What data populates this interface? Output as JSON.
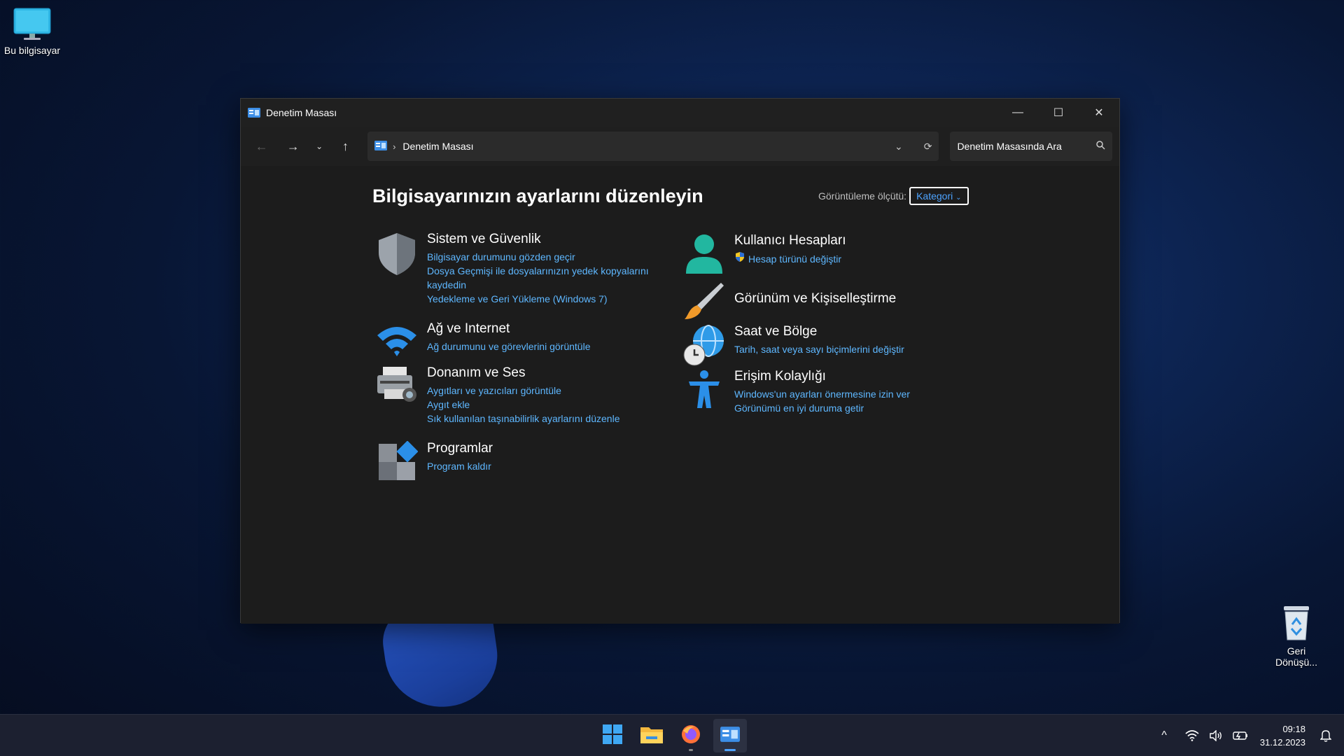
{
  "desktop": {
    "this_pc_label": "Bu bilgisayar",
    "recycle_bin_label_line1": "Geri",
    "recycle_bin_label_line2": "Dönüşü..."
  },
  "window": {
    "title": "Denetim Masası",
    "controls": {
      "minimize": "—",
      "maximize": "☐",
      "close": "✕"
    },
    "nav": {
      "back": "←",
      "forward": "→",
      "recent": "⌄",
      "up": "↑"
    },
    "address": {
      "crumb": "Denetim Masası",
      "separator": "›"
    },
    "search": {
      "placeholder": "Denetim Masasında Ara"
    },
    "page_title": "Bilgisayarınızın ayarlarını düzenleyin",
    "view_by": {
      "label": "Görüntüleme ölçütü:",
      "value": "Kategori"
    },
    "categories": [
      {
        "title": "Sistem ve Güvenlik",
        "links": [
          "Bilgisayar durumunu gözden geçir",
          "Dosya Geçmişi ile dosyalarınızın yedek kopyalarını",
          "kaydedin",
          "Yedekleme ve Geri Yükleme (Windows 7)"
        ]
      },
      {
        "title": "Ağ ve Internet",
        "links": [
          "Ağ durumunu ve görevlerini görüntüle"
        ]
      },
      {
        "title": "Donanım ve Ses",
        "links": [
          "Aygıtları ve yazıcıları görüntüle",
          "Aygıt ekle",
          "Sık kullanılan taşınabilirlik ayarlarını düzenle"
        ]
      },
      {
        "title": "Programlar",
        "links": [
          "Program kaldır"
        ]
      },
      {
        "title": "Kullanıcı Hesapları",
        "links": [
          "Hesap türünü değiştir"
        ]
      },
      {
        "title": "Görünüm ve Kişiselleştirme",
        "links": []
      },
      {
        "title": "Saat ve Bölge",
        "links": [
          "Tarih, saat veya sayı biçimlerini değiştir"
        ]
      },
      {
        "title": "Erişim Kolaylığı",
        "links": [
          "Windows'un ayarları önermesine izin ver",
          "Görünümü en iyi duruma getir"
        ]
      }
    ]
  },
  "taskbar": {
    "apps": [
      "start-icon",
      "file-explorer-icon",
      "firefox-icon",
      "control-panel-icon"
    ],
    "tray": {
      "chevron": "^",
      "time": "09:18",
      "date": "31.12.2023"
    }
  },
  "colors": {
    "link": "#5eb7ff",
    "accent": "#4da3ff",
    "window_bg": "#1c1c1c"
  }
}
